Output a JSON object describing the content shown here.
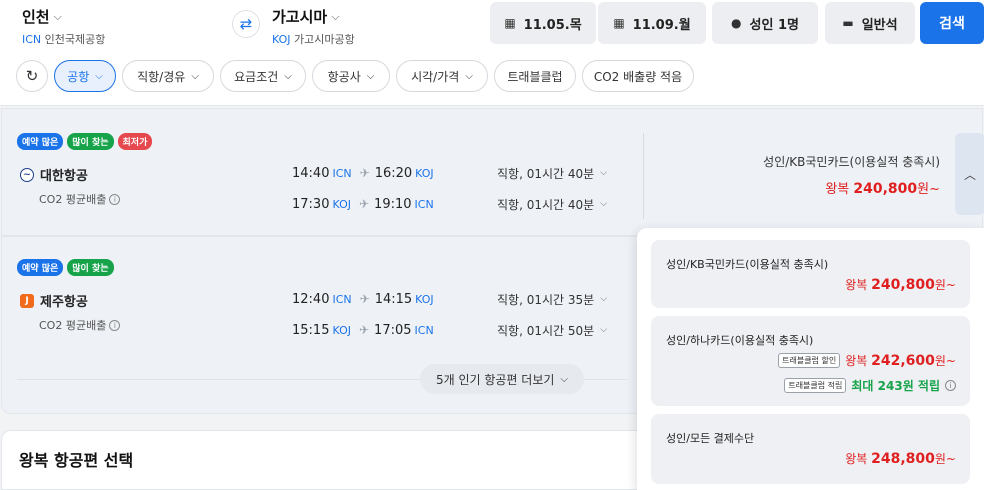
{
  "header": {
    "origin": {
      "city": "인천",
      "code": "ICN",
      "airport": "인천국제공항"
    },
    "destination": {
      "city": "가고시마",
      "code": "KOJ",
      "airport": "가고시마공항"
    },
    "swap_icon": "swap-arrows-icon",
    "depart_date": "11.05.목",
    "return_date": "11.09.월",
    "passengers": "성인 1명",
    "cabin": "일반석",
    "search_label": "검색"
  },
  "filters": {
    "refresh_icon": "refresh-icon",
    "chips": [
      "공항",
      "직항/경유",
      "요금조건",
      "항공사",
      "시각/가격",
      "트래블클럽",
      "CO2 배출량 적음"
    ]
  },
  "results": [
    {
      "badges": [
        "예약 많은",
        "많이 찾는",
        "최저가"
      ],
      "airline": "대한항공",
      "co2": "CO2 평균배출",
      "legs": [
        {
          "dep": "14:40",
          "dep_ap": "ICN",
          "arr": "16:20",
          "arr_ap": "KOJ",
          "duration": "직항, 01시간 40분"
        },
        {
          "dep": "17:30",
          "dep_ap": "KOJ",
          "arr": "19:10",
          "arr_ap": "ICN",
          "duration": "직항, 01시간 40분"
        }
      ],
      "price_label": "성인/KB국민카드(이용실적 충족시)",
      "price_prefix": "왕복",
      "price": "240,800",
      "price_suffix": "원~"
    },
    {
      "badges": [
        "예약 많은",
        "많이 찾는"
      ],
      "airline": "제주항공",
      "co2": "CO2 평균배출",
      "legs": [
        {
          "dep": "12:40",
          "dep_ap": "ICN",
          "arr": "14:15",
          "arr_ap": "KOJ",
          "duration": "직항, 01시간 35분"
        },
        {
          "dep": "15:15",
          "dep_ap": "KOJ",
          "arr": "17:05",
          "arr_ap": "ICN",
          "duration": "직항, 01시간 50분"
        }
      ]
    }
  ],
  "more_label": "5개 인기 항공편 더보기",
  "section_title": "왕복 항공편 선택",
  "price_options": [
    {
      "label": "성인/KB국민카드(이용실적 충족시)",
      "prefix": "왕복",
      "price": "240,800",
      "suffix": "원~"
    },
    {
      "label": "성인/하나카드(이용실적 충족시)",
      "tag1": "트래블클럽 할인",
      "prefix": "왕복",
      "price": "242,600",
      "suffix": "원~",
      "tag2": "트래블클럽 적립",
      "reward": "최대 243원 적립"
    },
    {
      "label": "성인/모든 결제수단",
      "prefix": "왕복",
      "price": "248,800",
      "suffix": "원~"
    }
  ],
  "colors": {
    "accent": "#1a73e8",
    "price": "#e02020",
    "reward": "#16a34a"
  }
}
